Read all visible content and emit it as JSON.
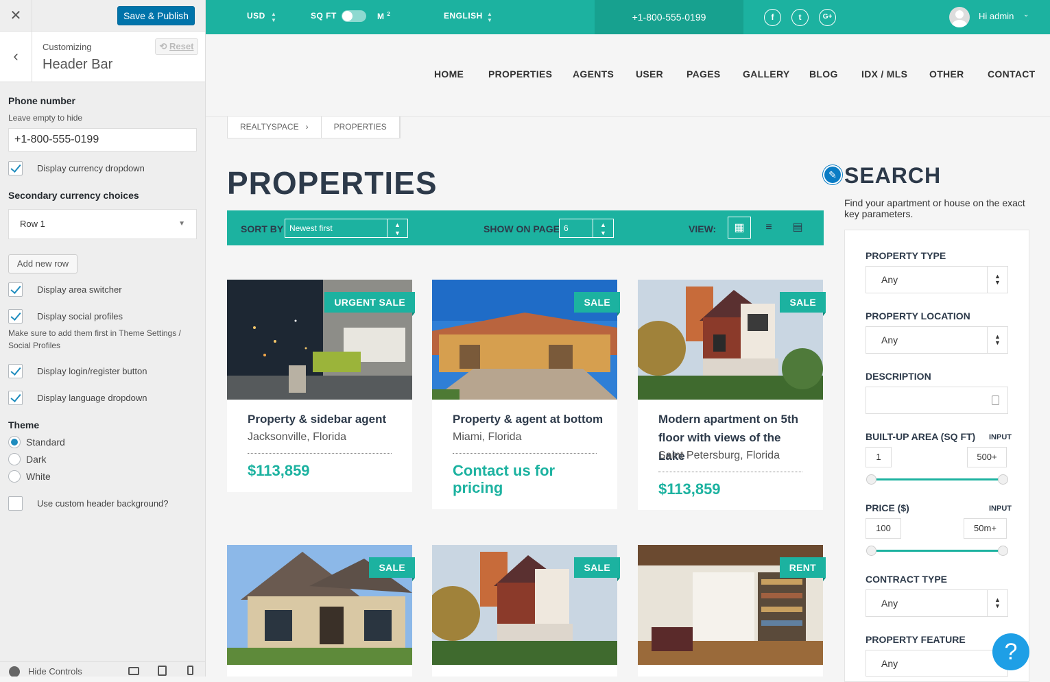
{
  "customizer": {
    "save_label": "Save & Publish",
    "reset_label": "Reset",
    "subtitle": "Customizing",
    "title": "Header Bar",
    "phone_label": "Phone number",
    "phone_desc": "Leave empty to hide",
    "phone_value": "+1-800-555-0199",
    "currency_dropdown_label": "Display currency dropdown",
    "secondary_currency_label": "Secondary currency choices",
    "row_select_value": "Row 1",
    "add_row_label": "Add new row",
    "area_switcher_label": "Display area switcher",
    "social_profiles_label": "Display social profiles",
    "social_profiles_desc": "Make sure to add them first in Theme Settings / Social Profiles",
    "login_button_label": "Display login/register button",
    "language_dropdown_label": "Display language dropdown",
    "theme_label": "Theme",
    "theme_options": [
      "Standard",
      "Dark",
      "White"
    ],
    "theme_selected": "Standard",
    "custom_bg_label": "Use custom header background?",
    "hide_controls_label": "Hide Controls"
  },
  "topbar": {
    "currency": "USD",
    "area_unit_left": "SQ FT",
    "area_unit_right": "M",
    "area_unit_sup": "2",
    "language": "ENGLISH",
    "phone": "+1-800-555-0199",
    "greeting": "Hi admin"
  },
  "nav": {
    "items": [
      "HOME",
      "PROPERTIES",
      "AGENTS",
      "USER",
      "PAGES",
      "GALLERY",
      "BLOG",
      "IDX / MLS",
      "OTHER",
      "CONTACT"
    ]
  },
  "breadcrumb": [
    "REALTYSPACE",
    "PROPERTIES"
  ],
  "page_title": "PROPERTIES",
  "toolbar": {
    "sort_label": "SORT BY",
    "sort_value": "Newest first",
    "show_label": "SHOW ON PAGE",
    "show_value": "6",
    "view_label": "VIEW:"
  },
  "listings": [
    {
      "badge": "URGENT SALE",
      "title": "Property & sidebar agent",
      "location": "Jacksonville, Florida",
      "price": "$113,859"
    },
    {
      "badge": "SALE",
      "title": "Property & agent at bottom",
      "location": "Miami, Florida",
      "price": "Contact us for pricing"
    },
    {
      "badge": "SALE",
      "title": "Modern apartment on 5th floor with views of the Lake",
      "location": "Saint Petersburg, Florida",
      "price": "$113,859"
    },
    {
      "badge": "SALE"
    },
    {
      "badge": "SALE"
    },
    {
      "badge": "RENT"
    }
  ],
  "search": {
    "title": "SEARCH",
    "subtitle": "Find your apartment or house on the exact key parameters.",
    "property_type_label": "PROPERTY TYPE",
    "property_type_value": "Any",
    "property_location_label": "PROPERTY LOCATION",
    "property_location_value": "Any",
    "description_label": "DESCRIPTION",
    "area_label": "BUILT-UP AREA (SQ FT)",
    "area_input_label": "INPUT",
    "area_min": "1",
    "area_max": "500+",
    "price_label": "PRICE ($)",
    "price_input_label": "INPUT",
    "price_min": "100",
    "price_max": "50m+",
    "contract_type_label": "CONTRACT TYPE",
    "contract_type_value": "Any",
    "property_feature_label": "PROPERTY FEATURE",
    "property_feature_value": "Any"
  },
  "colors": {
    "accent": "#1cb2a0",
    "brand_dark": "#2d3a4a",
    "wp_blue": "#0073aa",
    "help": "#1e9fe6"
  }
}
